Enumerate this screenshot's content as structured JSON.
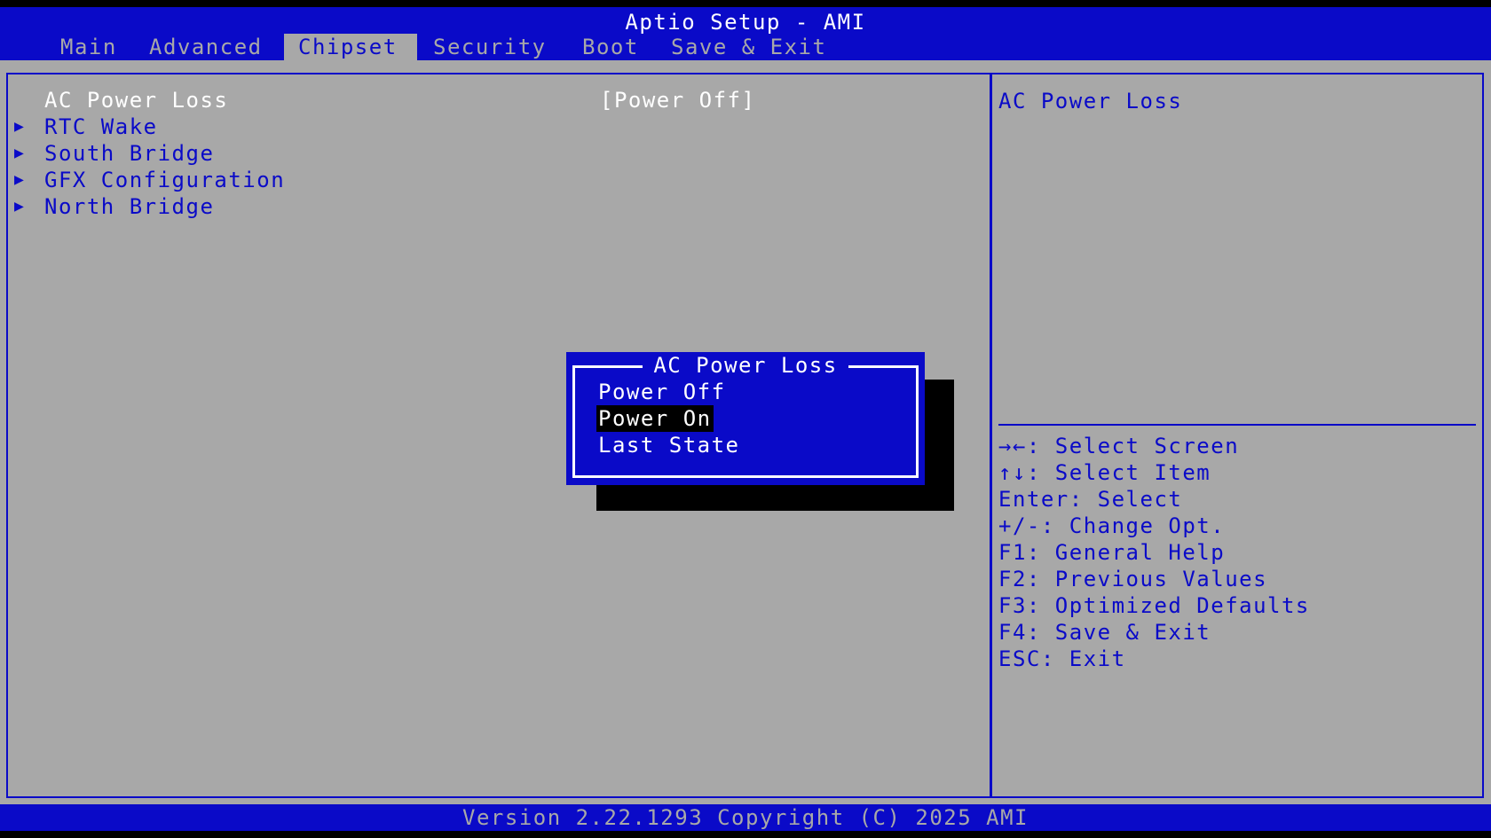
{
  "header": {
    "title": "Aptio Setup - AMI",
    "tabs": [
      {
        "label": "Main"
      },
      {
        "label": "Advanced"
      },
      {
        "label": "Chipset"
      },
      {
        "label": "Security"
      },
      {
        "label": "Boot"
      },
      {
        "label": "Save & Exit"
      }
    ],
    "active_tab": "Chipset"
  },
  "main": {
    "items": [
      {
        "label": "AC Power Loss",
        "value": "[Power Off]",
        "submenu": false,
        "selected": true
      },
      {
        "label": "RTC Wake",
        "submenu": true
      },
      {
        "label": "South Bridge",
        "submenu": true
      },
      {
        "label": "GFX Configuration",
        "submenu": true
      },
      {
        "label": "North Bridge",
        "submenu": true
      }
    ],
    "submenu_icon": "triangle-right-icon"
  },
  "help": {
    "title": "AC Power Loss",
    "keys": [
      "→←: Select Screen",
      "↑↓: Select Item",
      "Enter: Select",
      "+/-: Change Opt.",
      "F1: General Help",
      "F2: Previous Values",
      "F3: Optimized Defaults",
      "F4: Save & Exit",
      "ESC: Exit"
    ]
  },
  "popup": {
    "title": "AC Power Loss",
    "options": [
      "Power Off",
      "Power On",
      "Last State"
    ],
    "highlighted": "Power On"
  },
  "footer": {
    "text": "Version 2.22.1293 Copyright (C) 2025 AMI"
  },
  "colors": {
    "bios_blue": "#0a0ac8",
    "panel_gray": "#a8a8a8",
    "highlight_text": "#ffffff",
    "shadow": "#000000"
  }
}
